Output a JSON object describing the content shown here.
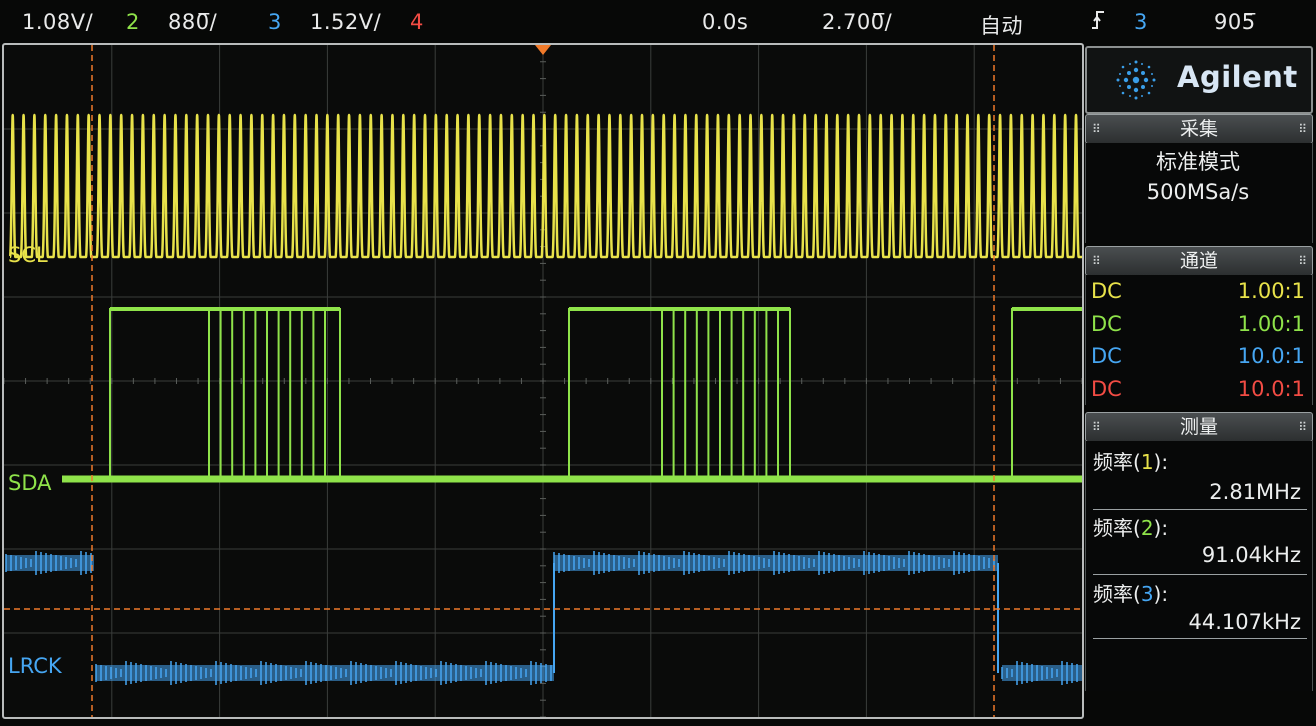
{
  "top_bar": {
    "ch1_scale": "1.08V/",
    "ch2_num": "2",
    "ch2_scale": "880̅/",
    "ch3_num": "3",
    "ch3_scale": "1.52V/",
    "ch4_num": "4",
    "delay": "0.0s",
    "timebase": "2.700̅/",
    "trigger_mode": "自动",
    "trigger_icon": "trigger-edge-icon",
    "trigger_source": "3",
    "trigger_level": "905̅"
  },
  "screen": {
    "ch1_label": "SCL",
    "ch2_label": "SDA",
    "ch3_label": "LRCK"
  },
  "panel": {
    "brand": "Agilent",
    "acquisition": {
      "title": "采集",
      "mode": "标准模式",
      "sample_rate": "500MSa/s"
    },
    "channels": {
      "title": "通道",
      "rows": [
        {
          "coupling": "DC",
          "probe": "1.00:1",
          "color": "#e8e24a"
        },
        {
          "coupling": "DC",
          "probe": "1.00:1",
          "color": "#8fe34a"
        },
        {
          "coupling": "DC",
          "probe": "10.0:1",
          "color": "#46a6f2"
        },
        {
          "coupling": "DC",
          "probe": "10.0:1",
          "color": "#f24c44"
        }
      ]
    },
    "measurements": {
      "title": "测量",
      "items": [
        {
          "label_prefix": "频率(",
          "channel": "1",
          "label_suffix": "):",
          "value": "2.81MHz",
          "color": "#e8e24a"
        },
        {
          "label_prefix": "频率(",
          "channel": "2",
          "label_suffix": "):",
          "value": "91.04kHz",
          "color": "#8fe34a"
        },
        {
          "label_prefix": "频率(",
          "channel": "3",
          "label_suffix": "):",
          "value": "44.107kHz",
          "color": "#46a6f2"
        }
      ]
    }
  },
  "colors": {
    "ch1": "#e8e24a",
    "ch2": "#8fe34a",
    "ch3": "#46a6f2",
    "ch4": "#f24c44",
    "cursor": "#f07a2a"
  }
}
